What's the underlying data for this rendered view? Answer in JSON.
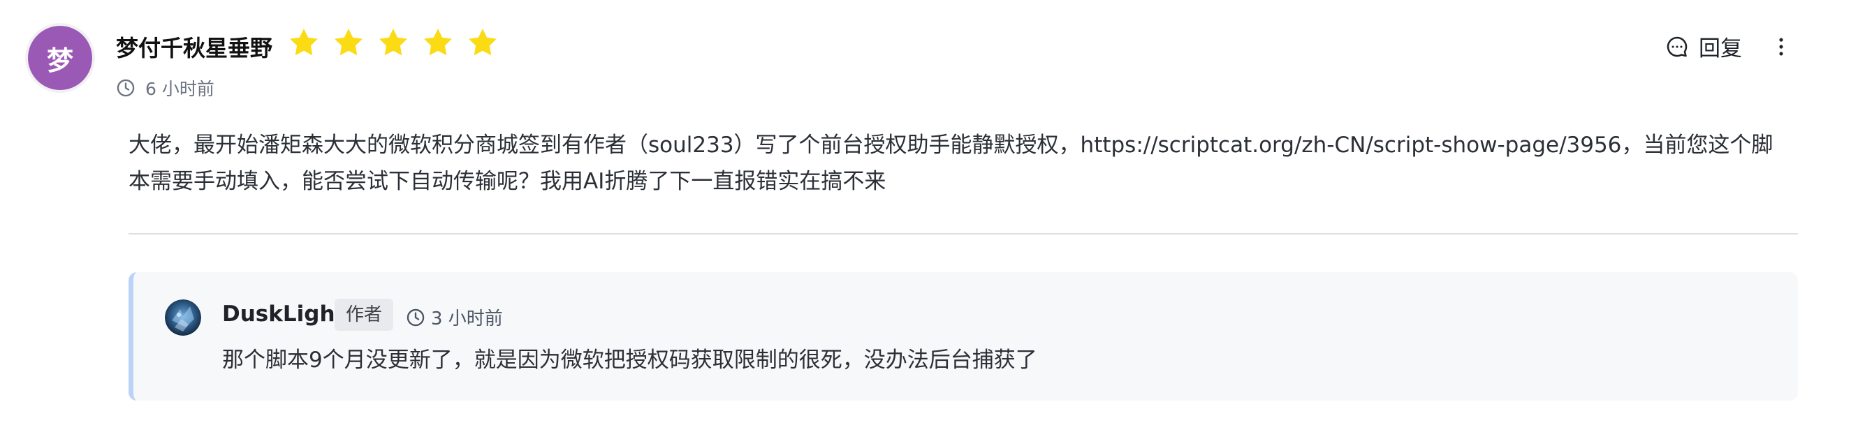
{
  "comment": {
    "avatar_char": "梦",
    "avatar_color": "#9b59b6",
    "username": "梦付千秋星垂野",
    "rating": 5,
    "rating_max": 5,
    "star_color": "#fadb14",
    "time": "6 小时前",
    "reply_label": "回复",
    "content": "大佬，最开始潘矩森大大的微软积分商城签到有作者（soul233）写了个前台授权助手能静默授权，https://scriptcat.org/zh-CN/script-show-page/3956，当前您这个脚本需要手动填入，能否尝试下自动传输呢？我用AI折腾了下一直报错实在搞不来"
  },
  "reply": {
    "username": "DuskLight",
    "badge": "作者",
    "time": "3 小时前",
    "text": "那个脚本9个月没更新了，就是因为微软把授权码获取限制的很死，没办法后台捕获了",
    "accent_color": "#bcd3f7"
  },
  "icons": {
    "clock": "clock-icon",
    "chat": "chat-bubble-icon",
    "more": "more-vertical-icon",
    "star": "star-icon"
  }
}
